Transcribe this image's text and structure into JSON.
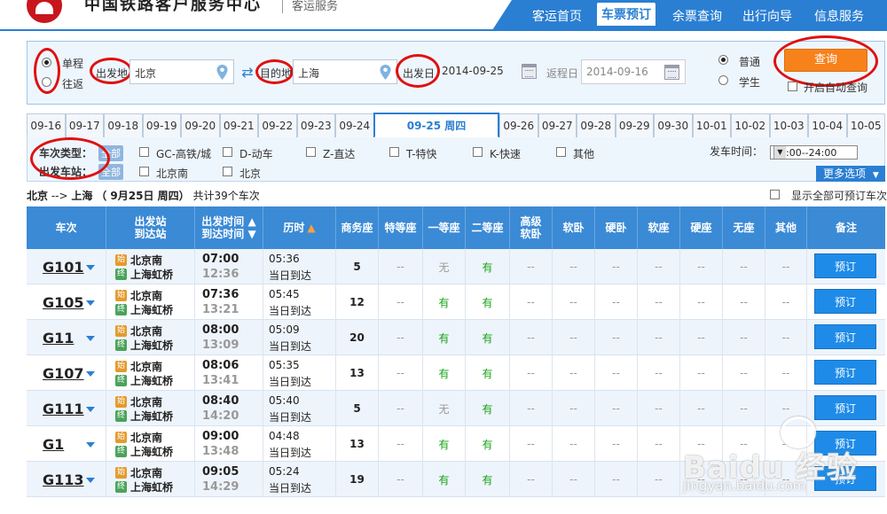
{
  "header": {
    "site_title": "中国铁路客户服务中心",
    "site_sub": "客运服务",
    "nav": [
      "客运首页",
      "车票预订",
      "余票查询",
      "出行向导",
      "信息服务"
    ],
    "nav_active": "车票预订"
  },
  "search": {
    "trip_one_way": "单程",
    "trip_round": "往返",
    "from_label": "出发地",
    "from_value": "北京",
    "to_label": "目的地",
    "to_value": "上海",
    "depart_label": "出发日",
    "depart_value": "2014-09-25",
    "return_label": "返程日",
    "return_value": "2014-09-16",
    "ticket_normal": "普通",
    "ticket_student": "学生",
    "search_button": "查询",
    "auto_query": "开启自动查询"
  },
  "dates": {
    "before": [
      "09-16",
      "09-17",
      "09-18",
      "09-19",
      "09-20",
      "09-21",
      "09-22",
      "09-23",
      "09-24"
    ],
    "active": "09-25 周四",
    "after": [
      "09-26",
      "09-27",
      "09-28",
      "09-29",
      "09-30",
      "10-01",
      "10-02",
      "10-03",
      "10-04",
      "10-05"
    ]
  },
  "filters": {
    "train_type_label": "车次类型：",
    "station_label": "出发车站：",
    "all_chip": "全部",
    "train_types": [
      "GC-高铁/城",
      "D-动车",
      "Z-直达",
      "T-特快",
      "K-快速",
      "其他"
    ],
    "stations": [
      "北京南",
      "北京"
    ],
    "depart_time_label": "发车时间：",
    "depart_time_value": "00:00--24:00",
    "more_options": "更多选项"
  },
  "summary": {
    "route_from": "北京",
    "route_arrow": "-->",
    "route_to": "上海",
    "date_text": "（ 9月25日  周四）",
    "count_text": "共计39个车次",
    "show_all": "显示全部可预订车次"
  },
  "table": {
    "headers": {
      "train": "车次",
      "station1": "出发站",
      "station2": "到达站",
      "time1": "出发时间",
      "time2": "到达时间",
      "duration": "历时",
      "seats": [
        "商务座",
        "特等座",
        "一等座",
        "二等座",
        "高级软卧",
        "软卧",
        "硬卧",
        "软座",
        "硬座",
        "无座",
        "其他"
      ],
      "note": "备注"
    },
    "start_icon": "始",
    "end_icon": "终",
    "rows": [
      {
        "train": "G101",
        "from": "北京南",
        "to": "上海虹桥",
        "dep": "07:00",
        "arr": "12:36",
        "dur": "05:36",
        "day": "当日到达",
        "seats": [
          "5",
          "--",
          "无",
          "有",
          "--",
          "--",
          "--",
          "--",
          "--",
          "--",
          "--"
        ],
        "book": "预订"
      },
      {
        "train": "G105",
        "from": "北京南",
        "to": "上海虹桥",
        "dep": "07:36",
        "arr": "13:21",
        "dur": "05:45",
        "day": "当日到达",
        "seats": [
          "12",
          "--",
          "有",
          "有",
          "--",
          "--",
          "--",
          "--",
          "--",
          "--",
          "--"
        ],
        "book": "预订"
      },
      {
        "train": "G11",
        "from": "北京南",
        "to": "上海虹桥",
        "dep": "08:00",
        "arr": "13:09",
        "dur": "05:09",
        "day": "当日到达",
        "seats": [
          "20",
          "--",
          "有",
          "有",
          "--",
          "--",
          "--",
          "--",
          "--",
          "--",
          "--"
        ],
        "book": "预订"
      },
      {
        "train": "G107",
        "from": "北京南",
        "to": "上海虹桥",
        "dep": "08:06",
        "arr": "13:41",
        "dur": "05:35",
        "day": "当日到达",
        "seats": [
          "13",
          "--",
          "有",
          "有",
          "--",
          "--",
          "--",
          "--",
          "--",
          "--",
          "--"
        ],
        "book": "预订"
      },
      {
        "train": "G111",
        "from": "北京南",
        "to": "上海虹桥",
        "dep": "08:40",
        "arr": "14:20",
        "dur": "05:40",
        "day": "当日到达",
        "seats": [
          "5",
          "--",
          "无",
          "有",
          "--",
          "--",
          "--",
          "--",
          "--",
          "--",
          "--"
        ],
        "book": "预订"
      },
      {
        "train": "G1",
        "from": "北京南",
        "to": "上海虹桥",
        "dep": "09:00",
        "arr": "13:48",
        "dur": "04:48",
        "day": "当日到达",
        "seats": [
          "13",
          "--",
          "有",
          "有",
          "--",
          "--",
          "--",
          "--",
          "--",
          "--",
          "--"
        ],
        "book": "预订"
      },
      {
        "train": "G113",
        "from": "北京南",
        "to": "上海虹桥",
        "dep": "09:05",
        "arr": "14:29",
        "dur": "05:24",
        "day": "当日到达",
        "seats": [
          "19",
          "--",
          "有",
          "有",
          "--",
          "--",
          "--",
          "--",
          "--",
          "--",
          "--"
        ],
        "book": "预订"
      }
    ]
  },
  "watermark": {
    "text": "Baidu 经验",
    "url": "jingyan.baidu.com"
  },
  "colors": {
    "brand_blue": "#2a7fd3",
    "accent_orange": "#f7821b",
    "annotation_red": "#e01010",
    "available_green": "#17a317"
  }
}
